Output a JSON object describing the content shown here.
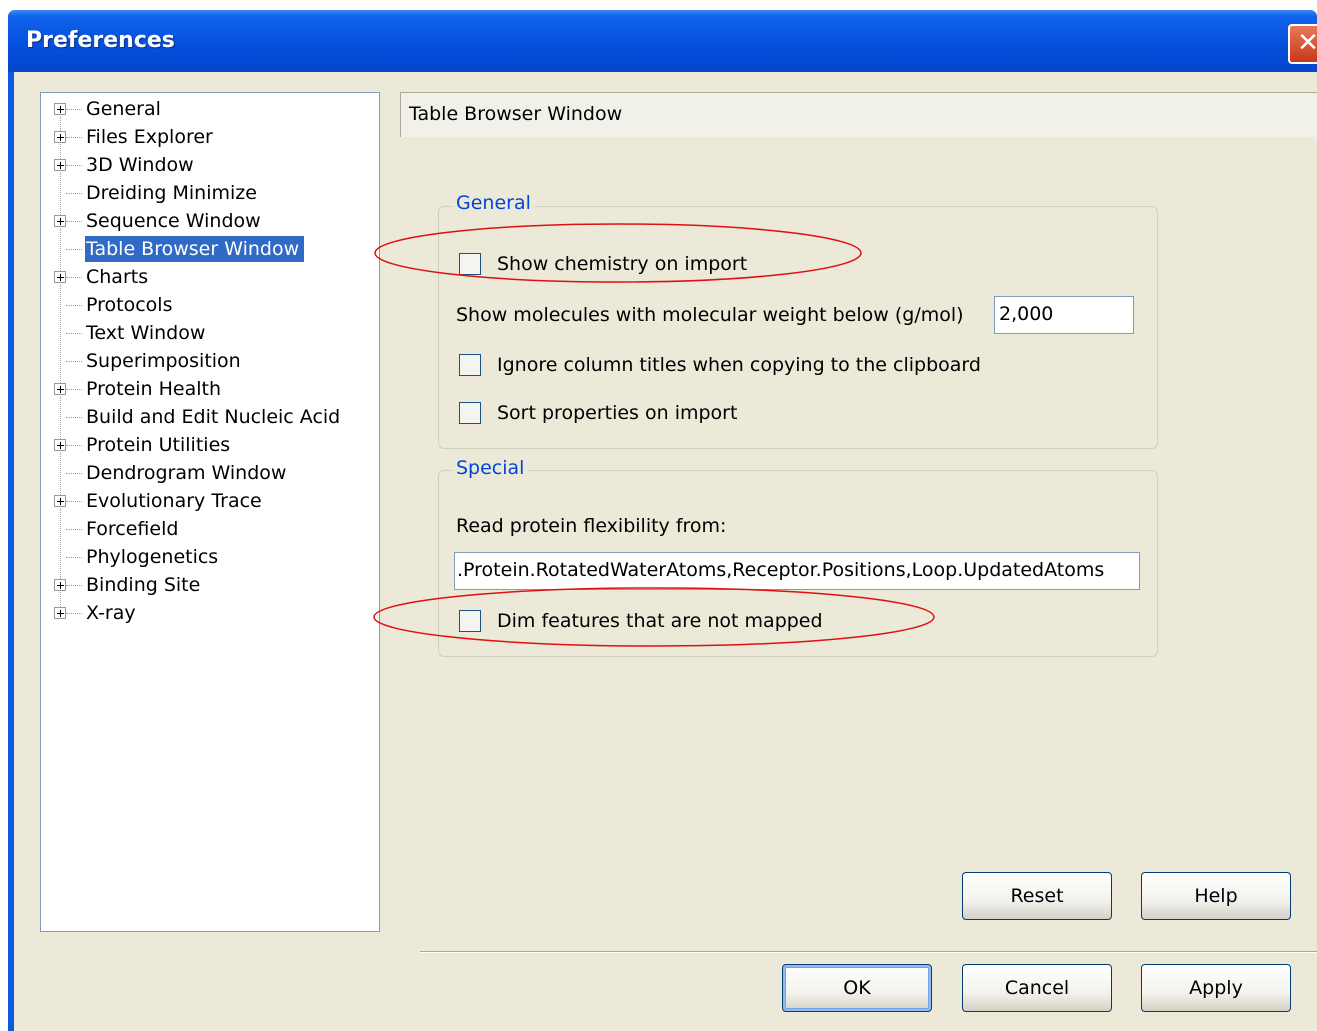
{
  "window": {
    "title": "Preferences",
    "close_glyph": "✕"
  },
  "tree": {
    "items": [
      {
        "label": "General",
        "expandable": true,
        "selected": false
      },
      {
        "label": "Files Explorer",
        "expandable": true,
        "selected": false
      },
      {
        "label": "3D Window",
        "expandable": true,
        "selected": false
      },
      {
        "label": "Dreiding Minimize",
        "expandable": false,
        "selected": false
      },
      {
        "label": "Sequence Window",
        "expandable": true,
        "selected": false
      },
      {
        "label": "Table Browser Window",
        "expandable": false,
        "selected": true
      },
      {
        "label": "Charts",
        "expandable": true,
        "selected": false
      },
      {
        "label": "Protocols",
        "expandable": false,
        "selected": false
      },
      {
        "label": "Text Window",
        "expandable": false,
        "selected": false
      },
      {
        "label": "Superimposition",
        "expandable": false,
        "selected": false
      },
      {
        "label": "Protein Health",
        "expandable": true,
        "selected": false
      },
      {
        "label": "Build and Edit Nucleic Acid",
        "expandable": false,
        "selected": false
      },
      {
        "label": "Protein Utilities",
        "expandable": true,
        "selected": false
      },
      {
        "label": "Dendrogram Window",
        "expandable": false,
        "selected": false
      },
      {
        "label": "Evolutionary Trace",
        "expandable": true,
        "selected": false
      },
      {
        "label": "Forcefield",
        "expandable": false,
        "selected": false
      },
      {
        "label": "Phylogenetics",
        "expandable": false,
        "selected": false
      },
      {
        "label": "Binding Site",
        "expandable": true,
        "selected": false
      },
      {
        "label": "X-ray",
        "expandable": true,
        "selected": false
      }
    ]
  },
  "panel": {
    "header": "Table Browser Window",
    "general": {
      "title": "General",
      "show_chemistry": {
        "label": "Show chemistry on import",
        "checked": false
      },
      "mw_label": "Show molecules with molecular weight below (g/mol)",
      "mw_value": "2,000",
      "ignore_titles": {
        "label": "Ignore column titles when copying to the clipboard",
        "checked": false
      },
      "sort_props": {
        "label": "Sort properties on import",
        "checked": false
      }
    },
    "special": {
      "title": "Special",
      "flex_label": "Read protein flexibility from:",
      "flex_value": ".Protein.RotatedWaterAtoms,Receptor.Positions,Loop.UpdatedAtoms",
      "dim_features": {
        "label": "Dim features that are not mapped",
        "checked": false
      }
    }
  },
  "buttons": {
    "reset": "Reset",
    "help": "Help",
    "ok": "OK",
    "cancel": "Cancel",
    "apply": "Apply"
  },
  "colors": {
    "titlebar": "#0550de",
    "selection": "#316ac5",
    "group_title": "#0046d5",
    "annotation_ellipse": "#e01010"
  }
}
